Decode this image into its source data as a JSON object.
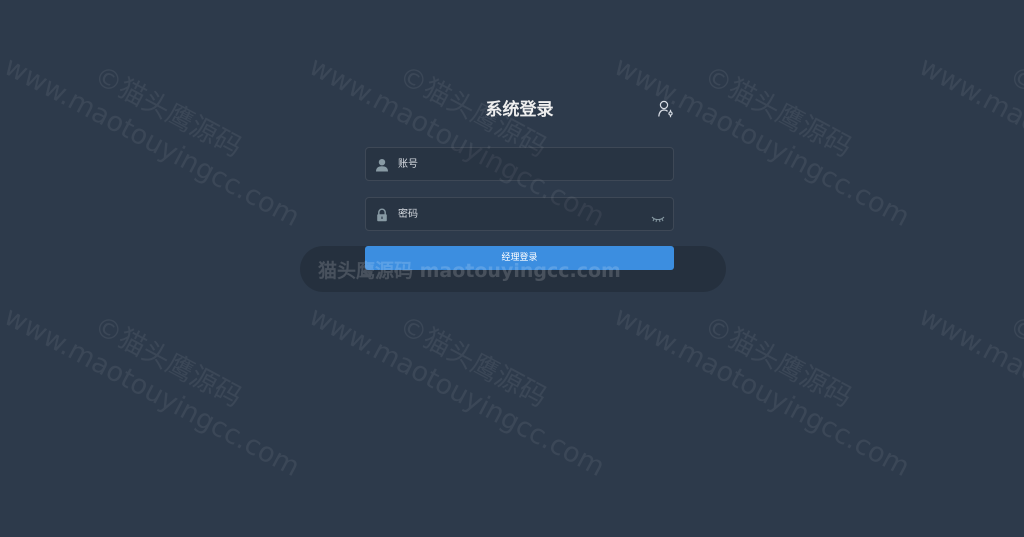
{
  "login": {
    "title": "系统登录",
    "switch_icon": "user-switch-icon",
    "username": {
      "icon": "user-icon",
      "placeholder": "账号",
      "value": ""
    },
    "password": {
      "icon": "lock-icon",
      "placeholder": "密码",
      "value": "",
      "toggle_icon": "eye-closed-icon"
    },
    "submit_label": "经理登录"
  },
  "watermark": {
    "line1": "www.maotouyingcc.com",
    "line2": "©猫头鹰源码",
    "banner": "猫头鹰源码 maotouyingcc.com"
  },
  "colors": {
    "background": "#2d3a4b",
    "button": "#3c8ee0",
    "title": "#eeeeee"
  }
}
